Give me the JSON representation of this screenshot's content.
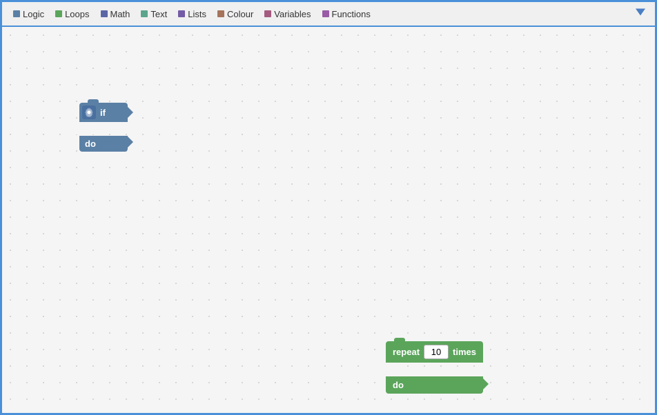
{
  "toolbar": {
    "items": [
      {
        "label": "Logic",
        "color": "#5b80a5",
        "id": "logic"
      },
      {
        "label": "Loops",
        "color": "#5ba55b",
        "id": "loops"
      },
      {
        "label": "Math",
        "color": "#5b67a5",
        "id": "math"
      },
      {
        "label": "Text",
        "color": "#5ba58c",
        "id": "text"
      },
      {
        "label": "Lists",
        "color": "#745ba5",
        "id": "lists"
      },
      {
        "label": "Colour",
        "color": "#a5745b",
        "id": "colour"
      },
      {
        "label": "Variables",
        "color": "#a55b80",
        "id": "variables"
      },
      {
        "label": "Functions",
        "color": "#995ba5",
        "id": "functions"
      }
    ]
  },
  "blocks": {
    "if_block": {
      "if_label": "if",
      "do_label": "do",
      "gear": "⚙"
    },
    "repeat_block": {
      "repeat_label": "repeat",
      "times_label": "times",
      "do_label": "do",
      "value": "10"
    }
  }
}
